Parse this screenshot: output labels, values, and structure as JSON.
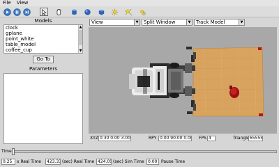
{
  "menu": {
    "file": "File",
    "view": "View"
  },
  "toolbar": {
    "icons": [
      "play-icon",
      "pause-icon",
      "step-icon",
      "arrow-select-icon",
      "hand-move-icon",
      "cylinder-icon",
      "sphere-icon",
      "box-icon",
      "point-light-icon",
      "spot-light-icon",
      "directional-light-icon"
    ],
    "selected": "arrow-select-icon"
  },
  "models": {
    "label": "Models",
    "items": [
      "clock",
      "gplane",
      "point_white",
      "table_model",
      "coffee_cup"
    ],
    "goto_label": "Go To"
  },
  "parameters": {
    "label": "Parameters"
  },
  "view_controls": {
    "view_select": "View",
    "window_select": "Split Window",
    "track_select": "Track Model"
  },
  "viewport_status": {
    "xyz_label": "XYZ",
    "xyz_value": "0.30  0.00  3.00",
    "rpy_label": "RPY",
    "rpy_value": "0.00  90.00  0.00",
    "fps_label": "FPS",
    "fps_value": "4",
    "triangles_label": "Triangles",
    "triangles_value": "65555"
  },
  "time": {
    "label": "Time:",
    "position": 0.0
  },
  "bottom_bar": {
    "real_time_factor": "0.25",
    "rtf_label": "x Real Time",
    "real_time": "423.33",
    "real_time_label": "(sec) Real Time",
    "sim_time": "424.05",
    "sim_time_label": "(sec) Sim Time",
    "pause_time": "0.00",
    "pause_time_label": "Pause Time"
  },
  "colors": {
    "background": "#a8a8a8",
    "table": "#d9a360",
    "robot_white": "#e8e8e8",
    "robot_dark": "#3a3a3a",
    "cup": "#b01818"
  }
}
